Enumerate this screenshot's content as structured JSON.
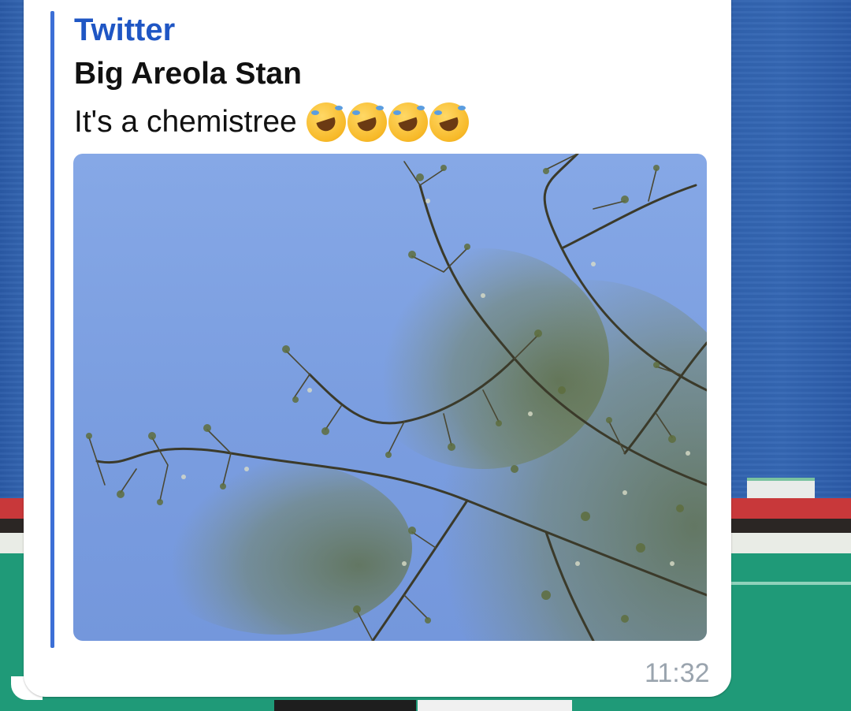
{
  "message": {
    "link_preview": {
      "site_name": "Twitter",
      "author": "Big Areola Stan",
      "text": "It's a chemistree",
      "emojis": [
        "rolling-on-floor-laughing",
        "rolling-on-floor-laughing",
        "rolling-on-floor-laughing",
        "rolling-on-floor-laughing"
      ]
    },
    "time": "11:32"
  },
  "colors": {
    "link_accent": "#1f56c4",
    "quote_bar": "#3c6fd6",
    "bubble": "#ffffff",
    "timestamp": "#9aa4ae"
  }
}
